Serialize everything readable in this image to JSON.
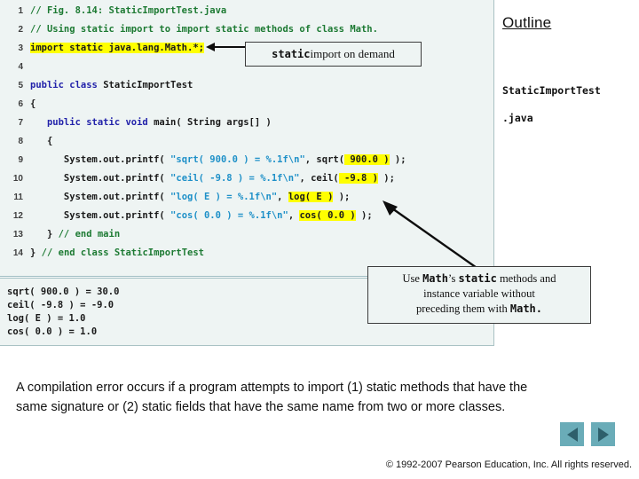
{
  "code_panel": {
    "lines": [
      {
        "number": "1",
        "segments": [
          {
            "text": "// Fig. 8.14: StaticImportTest.java",
            "style": "cmt",
            "highlight": false
          }
        ]
      },
      {
        "number": "2",
        "segments": [
          {
            "text": "// Using static import to import static methods of class Math.",
            "style": "cmt",
            "highlight": false
          }
        ]
      },
      {
        "number": "3",
        "segments": [
          {
            "text": "import static java.lang.Math.*;",
            "style": "kw",
            "highlight": true
          }
        ]
      },
      {
        "number": "4",
        "segments": [
          {
            "text": "",
            "style": "pln",
            "highlight": false
          }
        ]
      },
      {
        "number": "5",
        "segments": [
          {
            "text": "public class ",
            "style": "kw",
            "highlight": false
          },
          {
            "text": "StaticImportTest",
            "style": "pln",
            "highlight": false
          }
        ]
      },
      {
        "number": "6",
        "segments": [
          {
            "text": "{",
            "style": "pln",
            "highlight": false
          }
        ]
      },
      {
        "number": "7",
        "segments": [
          {
            "text": "   public static void ",
            "style": "kw",
            "highlight": false
          },
          {
            "text": "main( String args[] )",
            "style": "pln",
            "highlight": false
          }
        ]
      },
      {
        "number": "8",
        "segments": [
          {
            "text": "   {",
            "style": "pln",
            "highlight": false
          }
        ]
      },
      {
        "number": "9",
        "segments": [
          {
            "text": "      System.out.printf( ",
            "style": "pln",
            "highlight": false
          },
          {
            "text": "\"sqrt( 900.0 ) = %.1f\\n\"",
            "style": "str",
            "highlight": false
          },
          {
            "text": ", ",
            "style": "pln",
            "highlight": false
          },
          {
            "text": "sqrt(",
            "style": "pln",
            "highlight": false
          },
          {
            "text": " 900.0 )",
            "style": "pln",
            "highlight": true
          },
          {
            "text": " );",
            "style": "pln",
            "highlight": false
          }
        ]
      },
      {
        "number": "10",
        "segments": [
          {
            "text": "      System.out.printf( ",
            "style": "pln",
            "highlight": false
          },
          {
            "text": "\"ceil( -9.8 ) = %.1f\\n\"",
            "style": "str",
            "highlight": false
          },
          {
            "text": ", ",
            "style": "pln",
            "highlight": false
          },
          {
            "text": "ceil(",
            "style": "pln",
            "highlight": false
          },
          {
            "text": " -9.8 )",
            "style": "pln",
            "highlight": true
          },
          {
            "text": " );",
            "style": "pln",
            "highlight": false
          }
        ]
      },
      {
        "number": "11",
        "segments": [
          {
            "text": "      System.out.printf( ",
            "style": "pln",
            "highlight": false
          },
          {
            "text": "\"log( E ) = %.1f\\n\"",
            "style": "str",
            "highlight": false
          },
          {
            "text": ", ",
            "style": "pln",
            "highlight": false
          },
          {
            "text": "log( E )",
            "style": "pln",
            "highlight": true
          },
          {
            "text": " );",
            "style": "pln",
            "highlight": false
          }
        ]
      },
      {
        "number": "12",
        "segments": [
          {
            "text": "      System.out.printf( ",
            "style": "pln",
            "highlight": false
          },
          {
            "text": "\"cos( 0.0 ) = %.1f\\n\"",
            "style": "str",
            "highlight": false
          },
          {
            "text": ", ",
            "style": "pln",
            "highlight": false
          },
          {
            "text": "cos( 0.0 )",
            "style": "pln",
            "highlight": true
          },
          {
            "text": " );",
            "style": "pln",
            "highlight": false
          }
        ]
      },
      {
        "number": "13",
        "segments": [
          {
            "text": "   } ",
            "style": "pln",
            "highlight": false
          },
          {
            "text": "// end main",
            "style": "cmt",
            "highlight": false
          }
        ]
      },
      {
        "number": "14",
        "segments": [
          {
            "text": "} ",
            "style": "pln",
            "highlight": false
          },
          {
            "text": "// end class StaticImportTest",
            "style": "cmt",
            "highlight": false
          }
        ]
      }
    ],
    "output_lines": [
      "sqrt( 900.0 ) = 30.0",
      "ceil( -9.8 ) = -9.0",
      "log( E ) = 1.0",
      "cos( 0.0 ) = 1.0"
    ]
  },
  "callouts": {
    "static_import": {
      "mono_part": "static",
      "text_part": " import on demand"
    },
    "use_math": {
      "line1_pre": "Use ",
      "line1_mono1": "Math",
      "line1_mid": "’s ",
      "line1_mono2": "static",
      "line1_post": " methods and",
      "line2": "instance variable without",
      "line3_pre": "preceding them with ",
      "line3_mono": "Math."
    }
  },
  "outline": {
    "title": "Outline",
    "filename_line1": "StaticImportTest",
    "filename_line2": ".java"
  },
  "bottom_note": "A compilation error occurs if a program attempts to import (1) static methods that have the same signature or (2) static fields that have the same name from two or more classes.",
  "nav": {
    "previous_label": "◀",
    "next_label": "▶"
  },
  "copyright": "© 1992-2007 Pearson Education, Inc.  All rights reserved.",
  "colors": {
    "panel_background": "#eef4f3",
    "highlight": "#ffff00",
    "comment": "#1d7a33",
    "keyword": "#2222aa",
    "string": "#1e90c8",
    "nav_button": "#6aacb8",
    "nav_arrow": "#2e5f6b"
  }
}
